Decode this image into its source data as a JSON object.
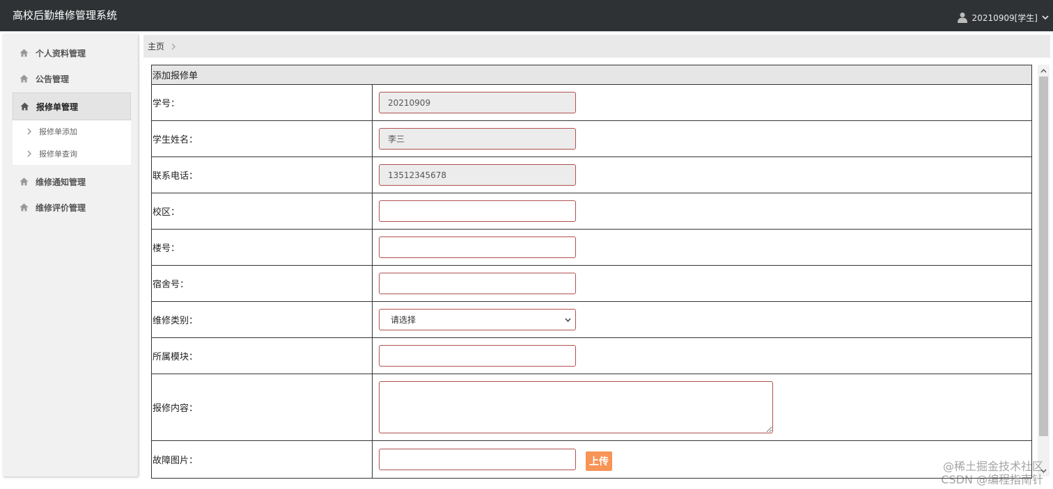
{
  "header": {
    "app_title": "高校后勤维修管理系统",
    "user_label": "20210909[学生]"
  },
  "sidebar": {
    "items": [
      {
        "label": "个人资料管理"
      },
      {
        "label": "公告管理"
      },
      {
        "label": "报修单管理"
      },
      {
        "label": "维修通知管理"
      },
      {
        "label": "维修评价管理"
      }
    ],
    "submenu": [
      {
        "label": "报修单添加"
      },
      {
        "label": "报修单查询"
      }
    ]
  },
  "breadcrumb": {
    "home": "主页"
  },
  "form": {
    "title": "添加报修单",
    "student_id_label": "学号：",
    "student_id_value": "20210909",
    "student_name_label": "学生姓名：",
    "student_name_value": "李三",
    "phone_label": "联系电话：",
    "phone_value": "13512345678",
    "campus_label": "校区：",
    "campus_value": "",
    "building_label": "楼号：",
    "building_value": "",
    "dorm_label": "宿舍号：",
    "dorm_value": "",
    "category_label": "维修类别：",
    "category_selected": "请选择",
    "module_label": "所属模块：",
    "module_value": "",
    "content_label": "报修内容：",
    "content_value": "",
    "image_label": "故障图片：",
    "image_value": "",
    "upload_label": "上传"
  },
  "watermark": {
    "line1": "@稀土掘金技术社区",
    "line2": "CSDN @编程指南针"
  },
  "icons": {
    "user": "user-icon",
    "home": "home-icon",
    "chevron": "chevron-right-icon",
    "caret": "chevron-down-icon"
  },
  "colors": {
    "topbar": "#2f3234",
    "input_border": "#b05050",
    "upload_button": "#f79456",
    "sidebar_bg": "#f1f1f1"
  }
}
